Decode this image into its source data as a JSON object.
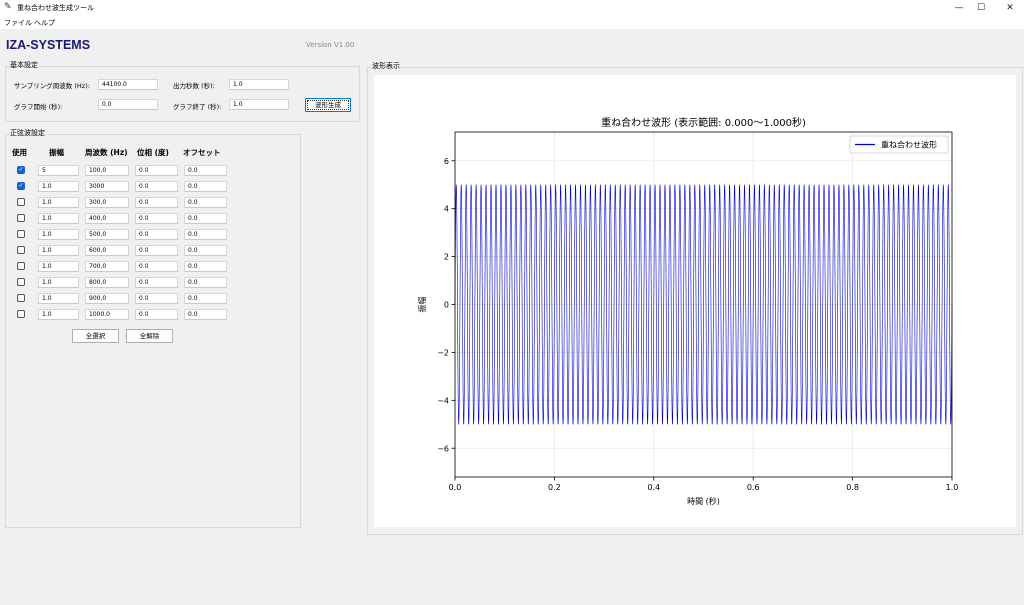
{
  "window": {
    "title": "重ね合わせ波生成ツール",
    "icon": "feather-icon",
    "minimize": "—",
    "maximize": "☐",
    "close": "✕"
  },
  "menu": [
    "ファイル",
    "ヘルプ"
  ],
  "brand": "IZA-SYSTEMS",
  "version": "Version V1.00",
  "basic": {
    "title": "基本設定",
    "sampling_label": "サンプリング周波数 (Hz):",
    "sampling_value": "44100.0",
    "duration_label": "出力秒数 (秒):",
    "duration_value": "1.0",
    "graph_start_label": "グラフ開始 (秒):",
    "graph_start_value": "0.0",
    "graph_end_label": "グラフ終了 (秒):",
    "graph_end_value": "1.0",
    "generate_button": "波形生成"
  },
  "sine": {
    "title": "正弦波設定",
    "headers": [
      "使用",
      "振幅",
      "周波数 (Hz)",
      "位相 (度)",
      "オフセット"
    ],
    "rows": [
      {
        "use": true,
        "amp": "5",
        "freq": "100.0",
        "phase": "0.0",
        "offset": "0.0"
      },
      {
        "use": true,
        "amp": "1.0",
        "freq": "3000",
        "phase": "0.0",
        "offset": "0.0"
      },
      {
        "use": false,
        "amp": "1.0",
        "freq": "300.0",
        "phase": "0.0",
        "offset": "0.0"
      },
      {
        "use": false,
        "amp": "1.0",
        "freq": "400.0",
        "phase": "0.0",
        "offset": "0.0"
      },
      {
        "use": false,
        "amp": "1.0",
        "freq": "500.0",
        "phase": "0.0",
        "offset": "0.0"
      },
      {
        "use": false,
        "amp": "1.0",
        "freq": "600.0",
        "phase": "0.0",
        "offset": "0.0"
      },
      {
        "use": false,
        "amp": "1.0",
        "freq": "700.0",
        "phase": "0.0",
        "offset": "0.0"
      },
      {
        "use": false,
        "amp": "1.0",
        "freq": "800.0",
        "phase": "0.0",
        "offset": "0.0"
      },
      {
        "use": false,
        "amp": "1.0",
        "freq": "900.0",
        "phase": "0.0",
        "offset": "0.0"
      },
      {
        "use": false,
        "amp": "1.0",
        "freq": "1000.0",
        "phase": "0.0",
        "offset": "0.0"
      }
    ],
    "select_all": "全選択",
    "deselect_all": "全解除"
  },
  "wave_panel_title": "波形表示",
  "chart_data": {
    "type": "line",
    "title": "重ね合わせ波形 (表示範囲: 0.000〜1.000秒)",
    "xlabel": "時間 (秒)",
    "ylabel": "振幅",
    "xlim": [
      0.0,
      1.0
    ],
    "ylim": [
      -7.2,
      7.2
    ],
    "xticks": [
      0.0,
      0.2,
      0.4,
      0.6,
      0.8,
      1.0
    ],
    "xtick_labels": [
      "0.0",
      "0.2",
      "0.4",
      "0.6",
      "0.8",
      "1.0"
    ],
    "yticks": [
      6,
      4,
      2,
      0,
      -2,
      -4,
      -6
    ],
    "ytick_labels": [
      "6",
      "4",
      "2",
      "0",
      "−2",
      "−4",
      "−6"
    ],
    "grid": true,
    "legend": "top-right",
    "color": "#0000cd",
    "series": [
      {
        "name": "重ね合わせ波形",
        "components": [
          {
            "amplitude": 5,
            "frequency": 100
          },
          {
            "amplitude": 1,
            "frequency": 3000
          }
        ]
      }
    ]
  }
}
